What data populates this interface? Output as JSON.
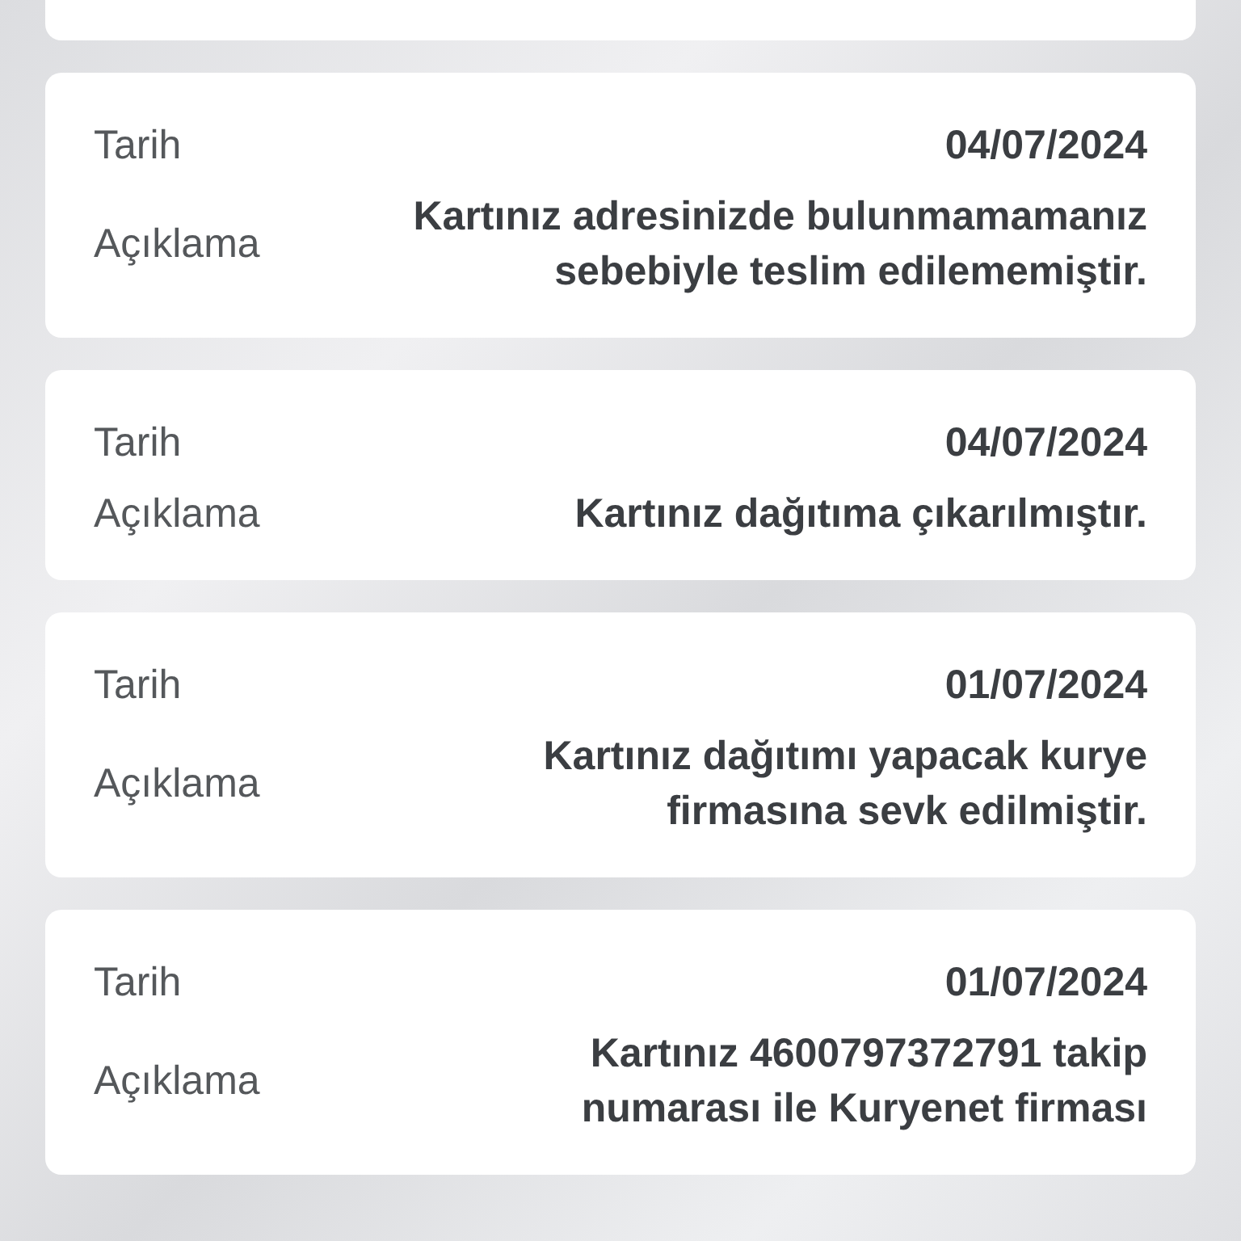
{
  "entries": [
    {
      "date_label": "Tarih",
      "date": "04/07/2024",
      "description_label": "Açıklama",
      "description": "Kartınız adresinizde bulunmamamanız sebebiyle teslim edilememiştir."
    },
    {
      "date_label": "Tarih",
      "date": "04/07/2024",
      "description_label": "Açıklama",
      "description": "Kartınız dağıtıma çıkarılmıştır."
    },
    {
      "date_label": "Tarih",
      "date": "01/07/2024",
      "description_label": "Açıklama",
      "description": "Kartınız dağıtımı yapacak kurye firmasına sevk edilmiştir."
    },
    {
      "date_label": "Tarih",
      "date": "01/07/2024",
      "description_label": "Açıklama",
      "description": "Kartınız 4600797372791 takip numarası ile Kuryenet firması"
    }
  ]
}
